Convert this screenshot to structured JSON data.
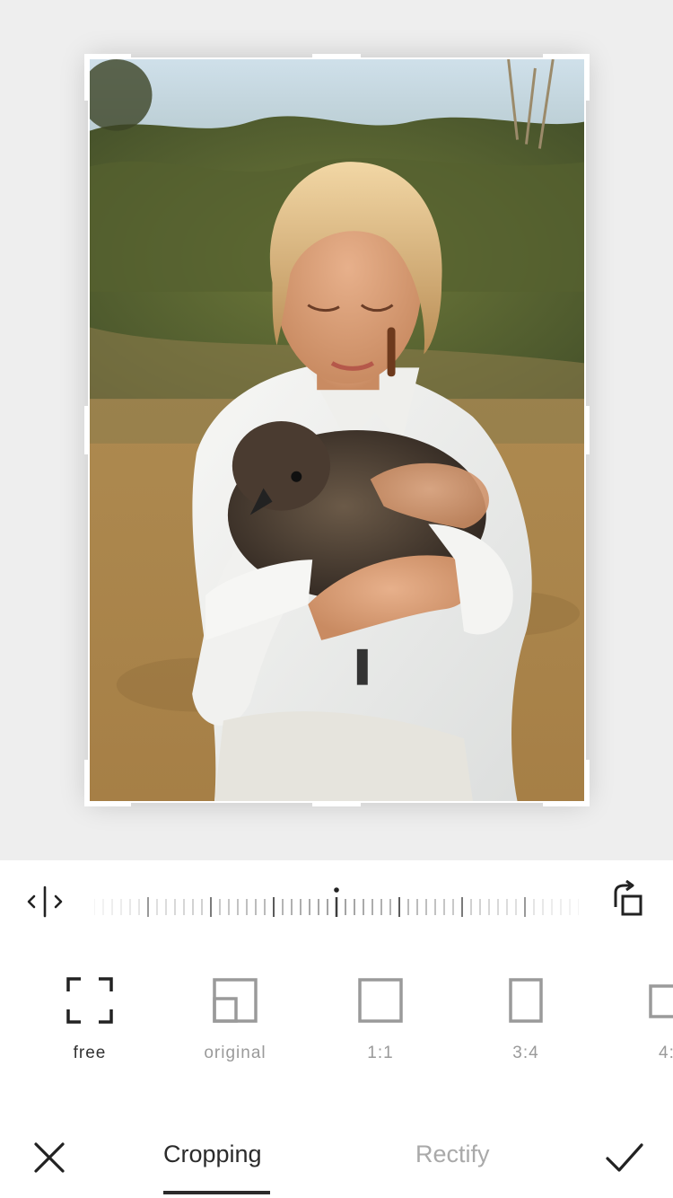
{
  "editor": {
    "image_alt": "Woman in white shirt holding a dark fluffy chicken in a dry field"
  },
  "controls": {
    "flip_icon": "flip-horizontal-icon",
    "rotate_icon": "rotate-icon"
  },
  "ratios": [
    {
      "label": "free",
      "icon": "free-crop-icon",
      "active": true
    },
    {
      "label": "original",
      "icon": "original-ratio-icon",
      "active": false
    },
    {
      "label": "1:1",
      "icon": "square-ratio-icon",
      "active": false
    },
    {
      "label": "3:4",
      "icon": "portrait-ratio-icon",
      "active": false
    },
    {
      "label": "4:",
      "icon": "landscape-ratio-icon",
      "active": false
    }
  ],
  "bottom": {
    "cancel_icon": "close-icon",
    "confirm_icon": "check-icon",
    "tabs": [
      {
        "label": "Cropping",
        "active": true
      },
      {
        "label": "Rectify",
        "active": false
      }
    ]
  },
  "colors": {
    "accent": "#2b2b2b",
    "inactive": "#9a9a9a",
    "canvas_bg": "#eeeeee"
  }
}
